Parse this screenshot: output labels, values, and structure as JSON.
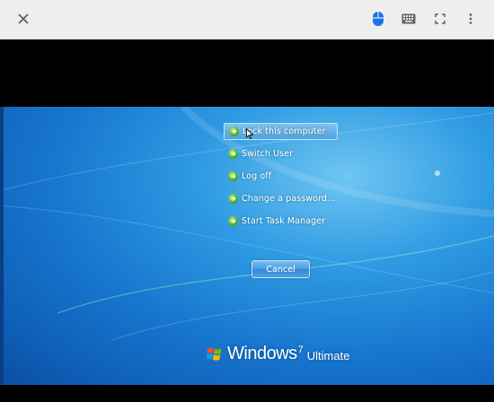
{
  "toolbar": {
    "icons": [
      "close-icon",
      "mouse-icon",
      "keyboard-icon",
      "fullscreen-icon",
      "more-vert-icon"
    ],
    "colors": {
      "background": "#eeeeee",
      "icon": "#5f6368",
      "active_icon": "#1a73e8"
    }
  },
  "screen": {
    "menu": [
      {
        "label": "Lock this computer",
        "selected": true
      },
      {
        "label": "Switch User",
        "selected": false
      },
      {
        "label": "Log off",
        "selected": false
      },
      {
        "label": "Change a password...",
        "selected": false
      },
      {
        "label": "Start Task Manager",
        "selected": false
      }
    ],
    "cancel_label": "Cancel",
    "branding": {
      "name": "Windows",
      "version": "7",
      "edition": "Ultimate"
    }
  }
}
